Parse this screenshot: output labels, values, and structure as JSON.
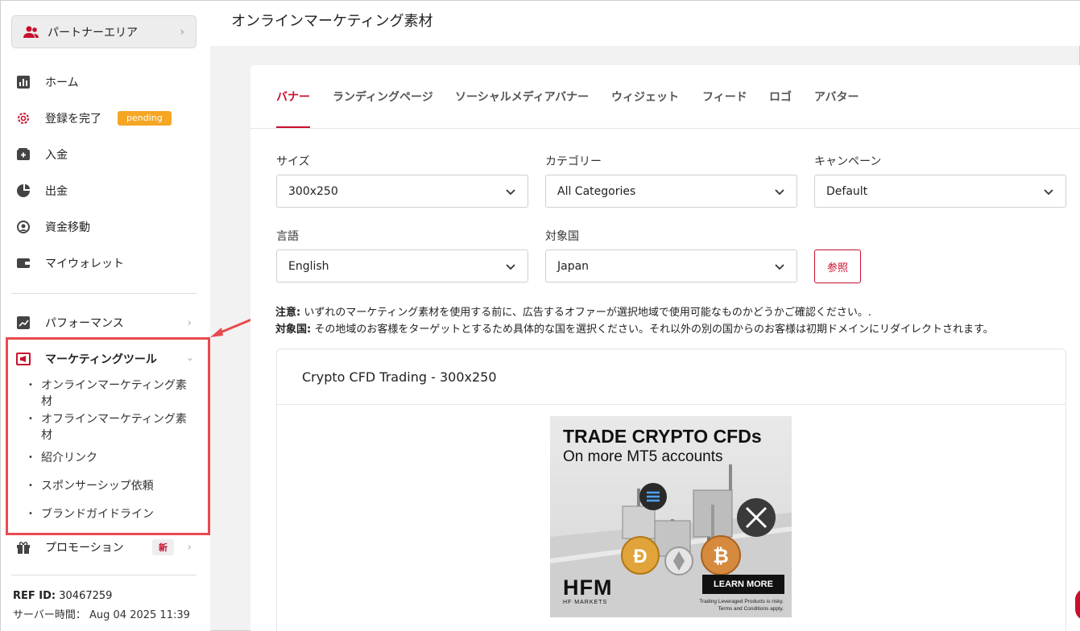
{
  "sidebar": {
    "partner_area": "パートナーエリア",
    "items": [
      {
        "label": "ホーム"
      },
      {
        "label": "登録を完了",
        "badge": "pending"
      },
      {
        "label": "入金"
      },
      {
        "label": "出金"
      },
      {
        "label": "資金移動"
      },
      {
        "label": "マイウォレット"
      },
      {
        "label": "パフォーマンス"
      },
      {
        "label": "マーケティングツール"
      },
      {
        "label": "プロモーション",
        "badge": "新"
      }
    ],
    "marketing_sub": [
      {
        "label": "オンラインマーケティング素材"
      },
      {
        "label": "オフラインマーケティング素材"
      },
      {
        "label": "紹介リンク"
      },
      {
        "label": "スポンサーシップ依頼"
      },
      {
        "label": "ブランドガイドライン"
      }
    ],
    "ref_label": "REF ID:",
    "ref_value": "30467259",
    "server_label": "サーバー時間：",
    "server_value": "Aug 04 2025 11:39"
  },
  "header": {
    "title": "オンラインマーケティング素材"
  },
  "tabs": [
    {
      "label": "バナー",
      "active": true
    },
    {
      "label": "ランディングページ"
    },
    {
      "label": "ソーシャルメディアバナー"
    },
    {
      "label": "ウィジェット"
    },
    {
      "label": "フィード"
    },
    {
      "label": "ロゴ"
    },
    {
      "label": "アバター"
    }
  ],
  "filters": {
    "size": {
      "label": "サイズ",
      "value": "300x250"
    },
    "category": {
      "label": "カテゴリー",
      "value": "All Categories"
    },
    "campaign": {
      "label": "キャンペーン",
      "value": "Default"
    },
    "language": {
      "label": "言語",
      "value": "English"
    },
    "country": {
      "label": "対象国",
      "value": "Japan"
    },
    "browse_button": "参照"
  },
  "notes": {
    "note1_label": "注意:",
    "note1_text": " いずれのマーケティング素材を使用する前に、広告するオファーが選択地域で使用可能なものかどうかご確認ください。.",
    "note2_label": "対象国:",
    "note2_text": " その地域のお客様をターゲットとするため具体的な国を選択ください。それ以外の別の国からのお客様は初期ドメインにリダイレクトされます。"
  },
  "banner": {
    "title": "Crypto CFD Trading - 300x250",
    "ad_headline": "TRADE CRYPTO CFDs",
    "ad_subline": "On more MT5 accounts",
    "ad_logo": "HFM",
    "ad_logo_sub": "HF MARKETS",
    "ad_cta": "LEARN MORE",
    "ad_disclaimer_1": "Trading Leveraged Products is risky.",
    "ad_disclaimer_2": "Terms and Conditions apply."
  },
  "colors": {
    "accent": "#c8102e",
    "pending": "#f5a623",
    "highlight": "#e84a4f"
  }
}
